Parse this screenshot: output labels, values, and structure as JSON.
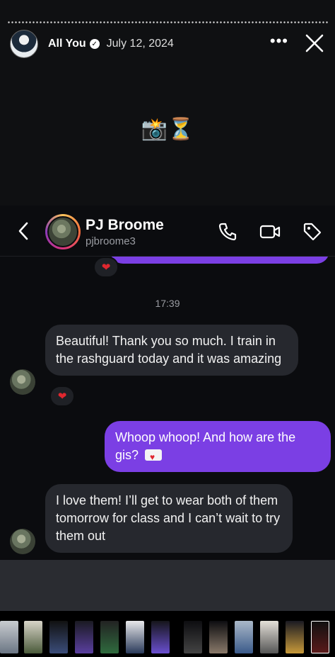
{
  "story": {
    "username": "All You",
    "date": "July 12, 2024",
    "emojis": "📸⏳",
    "more_icon": "more-horizontal-icon",
    "close_icon": "close-icon"
  },
  "chat": {
    "contact_name": "PJ Broome",
    "contact_handle": "pjbroome3",
    "icons": [
      "back-chevron-icon",
      "phone-icon",
      "video-camera-icon",
      "tag-icon"
    ],
    "reaction": "❤",
    "timestamp": "17:39",
    "messages": [
      {
        "from": "them",
        "text": "Beautiful! Thank you so much. I train in the rashguard today and it was amazing",
        "reaction": "❤"
      },
      {
        "from": "me",
        "text": "Whoop whoop! And how are the gis?",
        "emoji": "💌"
      },
      {
        "from": "them",
        "text": "I love them! I’ll get to wear both of them tomorrow for class and I can’t wait to try them out"
      }
    ]
  },
  "colors": {
    "outgoing_bubble": "#7b3fe4",
    "incoming_bubble": "#26282e",
    "background": "#0b0c0f",
    "reaction_heart": "#e0272f"
  },
  "thumbnails_count": 13
}
